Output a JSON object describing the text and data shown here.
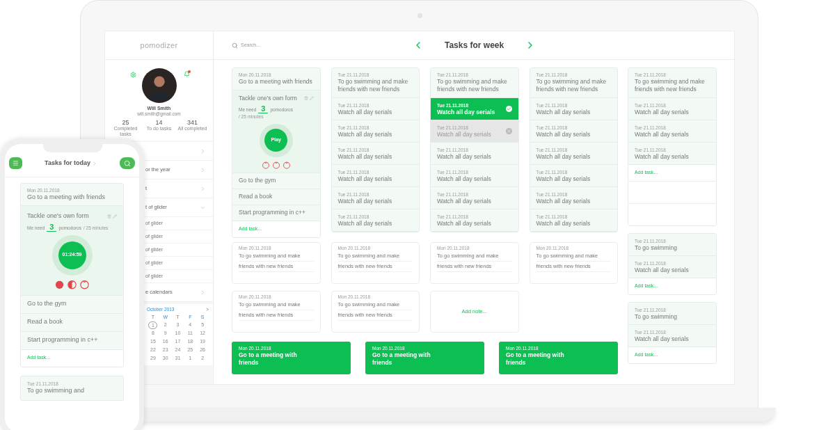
{
  "sidebar": {
    "logo": "pomodizer",
    "profile": {
      "name": "Will Smith",
      "email": "will.smith@gmail.com",
      "notification": true
    },
    "stats": [
      {
        "value": "25",
        "label": "Completed tasks"
      },
      {
        "value": "14",
        "label": "To do tasks"
      },
      {
        "value": "341",
        "label": "All completed"
      }
    ],
    "menu": [
      {
        "expanded": false
      },
      {
        "label": "or the year",
        "expanded": false
      },
      {
        "label": "t",
        "expanded": false
      },
      {
        "label": "t of glider",
        "expanded": true,
        "children": [
          {
            "label": "of glider"
          },
          {
            "label": "of glider"
          },
          {
            "label": "of glider"
          },
          {
            "label": "of glider"
          },
          {
            "label": "of glider"
          }
        ]
      },
      {
        "label": "e calendars",
        "expanded": false
      }
    ],
    "calendar": {
      "month": "October 2013",
      "next": ">",
      "weekdays": [
        "T",
        "W",
        "T",
        "F",
        "S"
      ],
      "days": [
        {
          "label": "1",
          "selected": true
        },
        {
          "label": "2",
          "selected": false
        },
        {
          "label": "3",
          "selected": false
        },
        {
          "label": "4",
          "selected": false
        },
        {
          "label": "5",
          "selected": false
        },
        {
          "label": "8",
          "selected": false
        },
        {
          "label": "9",
          "selected": false
        },
        {
          "label": "10",
          "selected": false
        },
        {
          "label": "11",
          "selected": false
        },
        {
          "label": "12",
          "selected": false
        },
        {
          "label": "15",
          "selected": false
        },
        {
          "label": "16",
          "selected": false
        },
        {
          "label": "17",
          "selected": false
        },
        {
          "label": "18",
          "selected": false
        },
        {
          "label": "19",
          "selected": false
        },
        {
          "label": "22",
          "selected": false
        },
        {
          "label": "23",
          "selected": false
        },
        {
          "label": "24",
          "selected": false
        },
        {
          "label": "25",
          "selected": false
        },
        {
          "label": "26",
          "selected": false
        },
        {
          "label": "29",
          "selected": false
        },
        {
          "label": "30",
          "selected": false
        },
        {
          "label": "31",
          "selected": false
        },
        {
          "label": "1",
          "selected": false
        },
        {
          "label": "2",
          "selected": false
        }
      ]
    }
  },
  "header": {
    "search_placeholder": "Search...",
    "title": "Tasks for week"
  },
  "columns": [
    {
      "items": [
        {
          "kind": "header",
          "date": "Mon 20.11.2018",
          "title": "Go to a meeting with friends"
        },
        {
          "kind": "focus",
          "title": "Tackle one's own form",
          "need_label": "Me need",
          "count": "3",
          "unit": "pomodoros",
          "extra": "/ 25 minutes",
          "button": "Play",
          "tomatoes": [
            {
              "kind": "empty"
            },
            {
              "kind": "empty"
            },
            {
              "kind": "empty"
            }
          ]
        },
        {
          "kind": "plain",
          "title": "Go to the gym"
        },
        {
          "kind": "plain",
          "title": "Read a book"
        },
        {
          "kind": "plain",
          "title": "Start programming in c++"
        },
        {
          "kind": "add",
          "title": "Add task..."
        }
      ]
    },
    {
      "items": [
        {
          "kind": "header",
          "date": "Tue 21.11.2018",
          "title": "To go swimming and make friends with new friends"
        },
        {
          "kind": "task",
          "date": "Tue 21.11.2018",
          "title": "Watch all day serials",
          "selected": false,
          "disabled": false
        },
        {
          "kind": "task",
          "date": "Tue 21.11.2018",
          "title": "Watch all day serials",
          "selected": false,
          "disabled": false
        },
        {
          "kind": "task",
          "date": "Tue 21.11.2018",
          "title": "Watch all day serials",
          "selected": false,
          "disabled": false
        },
        {
          "kind": "task",
          "date": "Tue 21.11.2018",
          "title": "Watch all day serials",
          "selected": false,
          "disabled": false
        },
        {
          "kind": "task",
          "date": "Tue 21.11.2018",
          "title": "Watch all day serials",
          "selected": false,
          "disabled": false
        },
        {
          "kind": "task",
          "date": "Tue 21.11.2018",
          "title": "Watch all day serials",
          "selected": false,
          "disabled": false
        }
      ]
    },
    {
      "items": [
        {
          "kind": "header",
          "date": "Tue 21.11.2018",
          "title": "To go swimming and make friends with new friends"
        },
        {
          "kind": "task",
          "date": "Tue 21.11.2018",
          "title": "Watch all day serials",
          "selected": true,
          "disabled": false
        },
        {
          "kind": "task",
          "date": "Tue 21.11.2018",
          "title": "Watch all day serials",
          "selected": false,
          "disabled": true
        },
        {
          "kind": "task",
          "date": "Tue 21.11.2018",
          "title": "Watch all day serials",
          "selected": false,
          "disabled": false
        },
        {
          "kind": "task",
          "date": "Tue 21.11.2018",
          "title": "Watch all day serials",
          "selected": false,
          "disabled": false
        },
        {
          "kind": "task",
          "date": "Tue 21.11.2018",
          "title": "Watch all day serials",
          "selected": false,
          "disabled": false
        },
        {
          "kind": "task",
          "date": "Tue 21.11.2018",
          "title": "Watch all day serials",
          "selected": false,
          "disabled": false
        }
      ]
    },
    {
      "items": [
        {
          "kind": "header",
          "date": "Tue 21.11.2018",
          "title": "To go swimming and make friends with new friends"
        },
        {
          "kind": "task",
          "date": "Tue 21.11.2018",
          "title": "Watch all day serials",
          "selected": false,
          "disabled": false
        },
        {
          "kind": "task",
          "date": "Tue 21.11.2018",
          "title": "Watch all day serials",
          "selected": false,
          "disabled": false
        },
        {
          "kind": "task",
          "date": "Tue 21.11.2018",
          "title": "Watch all day serials",
          "selected": false,
          "disabled": false
        },
        {
          "kind": "task",
          "date": "Tue 21.11.2018",
          "title": "Watch all day serials",
          "selected": false,
          "disabled": false
        },
        {
          "kind": "task",
          "date": "Tue 21.11.2018",
          "title": "Watch all day serials",
          "selected": false,
          "disabled": false
        },
        {
          "kind": "task",
          "date": "Tue 21.11.2018",
          "title": "Watch all day serials",
          "selected": false,
          "disabled": false
        }
      ]
    }
  ],
  "notes": [
    {
      "kind": "note",
      "date": "Mon 20.11.2018",
      "lines": [
        "To go swimming and make",
        "friends with new friends"
      ]
    },
    {
      "kind": "note",
      "date": "Mon 20.11.2018",
      "lines": [
        "To go swimming and make",
        "friends with new friends"
      ]
    },
    {
      "kind": "note",
      "date": "Mon 20.11.2018",
      "lines": [
        "To go swimming and make",
        "friends with new friends"
      ]
    },
    {
      "kind": "note",
      "date": "Mon 20.11.2018",
      "lines": [
        "To go swimming and make",
        "friends with new friends"
      ]
    },
    {
      "kind": "note",
      "date": "Mon 20.11.2018",
      "lines": [
        "To go swimming and make",
        "friends with new friends"
      ]
    },
    {
      "kind": "note",
      "date": "Mon 20.11.2018",
      "lines": [
        "To go swimming and make",
        "friends with new friends"
      ]
    },
    {
      "kind": "add",
      "label": "Add note..."
    }
  ],
  "highlights": [
    {
      "date": "Mon 20.11.2018",
      "title": "Go to a meeting with friends"
    },
    {
      "date": "Mon 20.11.2018",
      "title": "Go to a meeting with friends"
    },
    {
      "date": "Mon 20.11.2018",
      "title": "Go to a meeting with friends"
    }
  ],
  "side_column": [
    {
      "items": [
        {
          "kind": "header",
          "date": "Tue 21.11.2018",
          "title": "To go swimming and make friends with new friends"
        },
        {
          "kind": "task",
          "date": "Tue 21.11.2018",
          "title": "Watch all day serials",
          "selected": false,
          "disabled": false
        },
        {
          "kind": "task",
          "date": "Tue 21.11.2018",
          "title": "Watch all day serials",
          "selected": false,
          "disabled": false
        },
        {
          "kind": "task",
          "date": "Tue 21.11.2018",
          "title": "Watch all day serials",
          "selected": false,
          "disabled": false
        },
        {
          "kind": "add",
          "title": "Add task..."
        },
        {
          "kind": "blank"
        },
        {
          "kind": "blank"
        }
      ]
    },
    {
      "items": [
        {
          "kind": "task",
          "date": "Tue 21.11.2018",
          "title": "To go swimming",
          "selected": false,
          "disabled": false
        },
        {
          "kind": "task",
          "date": "Tue 21.11.2018",
          "title": "Watch all day serials",
          "selected": false,
          "disabled": false
        },
        {
          "kind": "add",
          "title": "Add task..."
        }
      ]
    },
    {
      "items": [
        {
          "kind": "task",
          "date": "Tue 21.11.2018",
          "title": "To go swimming",
          "selected": false,
          "disabled": false
        },
        {
          "kind": "task",
          "date": "Tue 21.11.2018",
          "title": "Watch all day serials",
          "selected": false,
          "disabled": false
        },
        {
          "kind": "add",
          "title": "Add task..."
        }
      ]
    }
  ],
  "phone": {
    "title": "Tasks for today",
    "cards": [
      {
        "items": [
          {
            "kind": "header",
            "date": "Mon 20.11.2018",
            "title": "Go to a meeting with friends"
          },
          {
            "kind": "focus",
            "title": "Tackle one's own form",
            "need_label": "Me need",
            "count": "3",
            "unit": "pomodoros",
            "extra": "/ 25 minutes",
            "button": "01:24:59",
            "tomatoes": [
              {
                "kind": "full"
              },
              {
                "kind": "half"
              },
              {
                "kind": "empty"
              }
            ]
          },
          {
            "kind": "plain",
            "title": "Go to the gym"
          },
          {
            "kind": "plain",
            "title": "Read a book"
          },
          {
            "kind": "plain",
            "title": "Start programming in c++"
          },
          {
            "kind": "add",
            "title": "Add task..."
          }
        ]
      },
      {
        "items": [
          {
            "kind": "header",
            "date": "Tue 21.11.2018",
            "title": "To go swimming and"
          }
        ]
      }
    ]
  }
}
